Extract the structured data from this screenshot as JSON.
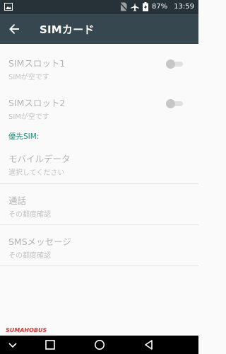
{
  "status_bar": {
    "battery": "87%",
    "time": "13:59",
    "icons": [
      "image-icon",
      "no-sim-icon",
      "airplane-mode-icon",
      "battery-charging-icon"
    ]
  },
  "app_bar": {
    "title": "SIMカード",
    "icons": [
      "back-arrow-icon"
    ]
  },
  "sim_slots": [
    {
      "label": "SIMスロット1",
      "status": "SIMが空です",
      "enabled": false
    },
    {
      "label": "SIMスロット2",
      "status": "SIMが空です",
      "enabled": false
    }
  ],
  "preferred_sim": {
    "header": "優先SIM:",
    "items": [
      {
        "label": "モバイルデータ",
        "value": "選択してください"
      },
      {
        "label": "通話",
        "value": "その都度確認"
      },
      {
        "label": "SMSメッセージ",
        "value": "その都度確認"
      }
    ]
  },
  "watermark": "SUMAHOBUS",
  "nav_bar": {
    "icons": [
      "chevron-down-icon",
      "recents-icon",
      "home-icon",
      "back-icon"
    ]
  },
  "colors": {
    "status_bar_bg": "#263238",
    "app_bar_bg": "#37474f",
    "accent": "#1e8e7a",
    "background": "#fafafa"
  }
}
